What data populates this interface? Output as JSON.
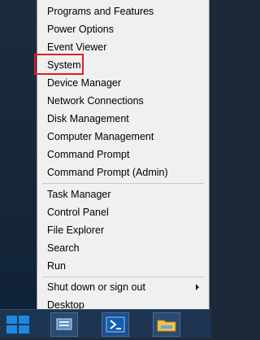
{
  "menu": {
    "items": [
      {
        "label": "Programs and Features"
      },
      {
        "label": "Power Options"
      },
      {
        "label": "Event Viewer"
      },
      {
        "label": "System"
      },
      {
        "label": "Device Manager"
      },
      {
        "label": "Network Connections"
      },
      {
        "label": "Disk Management"
      },
      {
        "label": "Computer Management"
      },
      {
        "label": "Command Prompt"
      },
      {
        "label": "Command Prompt (Admin)"
      },
      {
        "label": "Task Manager"
      },
      {
        "label": "Control Panel"
      },
      {
        "label": "File Explorer"
      },
      {
        "label": "Search"
      },
      {
        "label": "Run"
      },
      {
        "label": "Shut down or sign out"
      },
      {
        "label": "Desktop"
      }
    ]
  },
  "taskbar": {
    "icons": [
      "windows-start-icon",
      "server-manager-icon",
      "powershell-icon",
      "file-explorer-icon"
    ]
  },
  "colors": {
    "highlight_border": "#e02020",
    "menu_background": "#f0f0f0",
    "taskbar": "#1e3552"
  }
}
